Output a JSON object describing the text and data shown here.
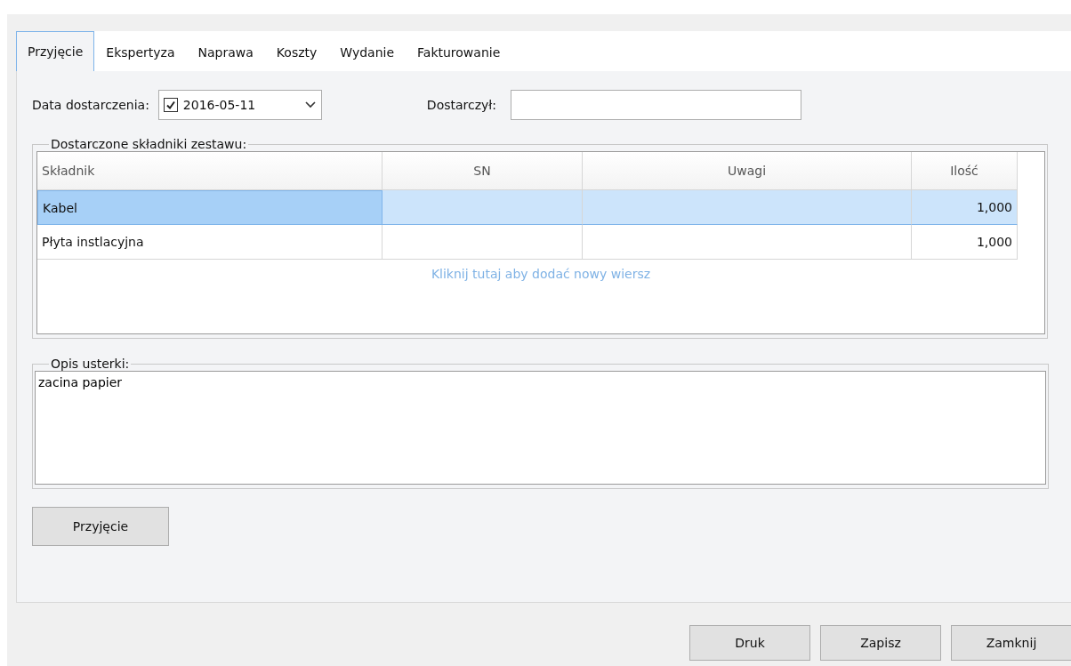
{
  "tabs": [
    {
      "label": "Przyjęcie",
      "selected": true
    },
    {
      "label": "Ekspertyza",
      "selected": false
    },
    {
      "label": "Naprawa",
      "selected": false
    },
    {
      "label": "Koszty",
      "selected": false
    },
    {
      "label": "Wydanie",
      "selected": false
    },
    {
      "label": "Fakturowanie",
      "selected": false
    }
  ],
  "delivery_date": {
    "label": "Data dostarczenia:",
    "checked": true,
    "value": "2016-05-11"
  },
  "delivered_by": {
    "label": "Dostarczył:"
  },
  "components": {
    "title": "Dostarczone składniki zestawu:",
    "columns": [
      "Składnik",
      "SN",
      "Uwagi",
      "Ilość"
    ],
    "rows": [
      {
        "cells": [
          "Kabel",
          "",
          "",
          "1,000"
        ],
        "selected": true
      },
      {
        "cells": [
          "Płyta instlacyjna",
          "",
          "",
          "1,000"
        ],
        "selected": false
      }
    ],
    "add_row_hint": "Kliknij tutaj aby dodać nowy wiersz"
  },
  "fault": {
    "title": "Opis usterki:",
    "value": "zacina papier"
  },
  "accept_button": "Przyjęcie",
  "footer_buttons": [
    "Druk",
    "Zapisz",
    "Zamknij"
  ]
}
